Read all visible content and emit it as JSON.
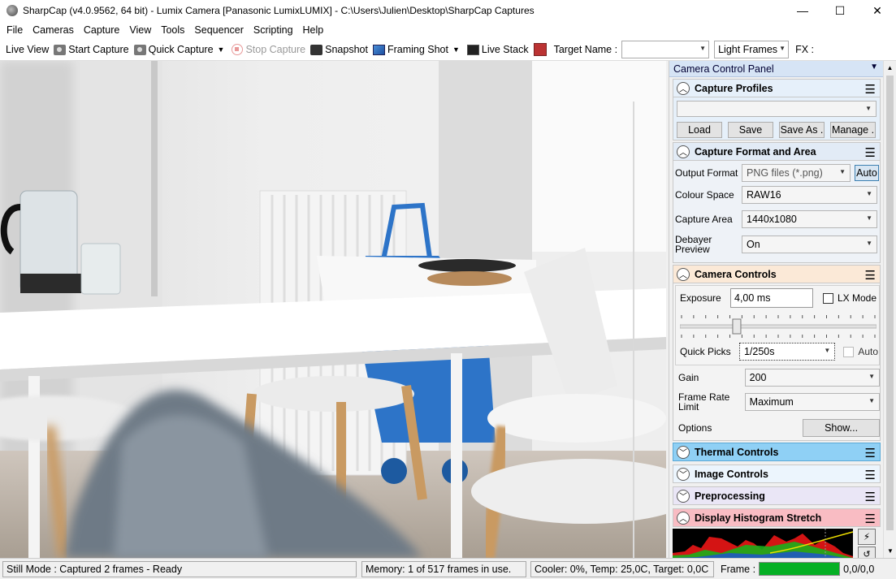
{
  "window": {
    "title": "SharpCap (v4.0.9562, 64 bit) - Lumix Camera [Panasonic LumixLUMIX] - C:\\Users\\Julien\\Desktop\\SharpCap Captures",
    "minimize": "—",
    "maximize": "☐",
    "close": "✕"
  },
  "menu": [
    "File",
    "Cameras",
    "Capture",
    "View",
    "Tools",
    "Sequencer",
    "Scripting",
    "Help"
  ],
  "toolbar": {
    "live_view": "Live View",
    "start_capture": "Start Capture",
    "quick_capture": "Quick Capture",
    "stop_capture": "Stop Capture",
    "snapshot": "Snapshot",
    "framing_shot": "Framing Shot",
    "live_stack": "Live Stack",
    "target_name_label": "Target Name :",
    "target_name_value": "",
    "frame_type": "Light Frames",
    "fx_label": "FX :"
  },
  "panel": {
    "title": "Camera Control Panel",
    "capture_profiles": {
      "title": "Capture Profiles",
      "profile": "",
      "load": "Load",
      "save": "Save",
      "save_as": "Save As .",
      "manage": "Manage ."
    },
    "format": {
      "title": "Capture Format and Area",
      "output_format_label": "Output Format",
      "output_format": "PNG files (*.png)",
      "auto": "Auto",
      "colour_space_label": "Colour Space",
      "colour_space": "RAW16",
      "capture_area_label": "Capture Area",
      "capture_area": "1440x1080",
      "debayer_label_1": "Debayer",
      "debayer_label_2": "Preview",
      "debayer": "On"
    },
    "camera": {
      "title": "Camera Controls",
      "exposure_label": "Exposure",
      "exposure": "4,00 ms",
      "lx_mode": "LX Mode",
      "quick_picks_label": "Quick Picks",
      "quick_picks": "1/250s",
      "qp_auto": "Auto",
      "gain_label": "Gain",
      "gain": "200",
      "frame_rate_label_1": "Frame Rate",
      "frame_rate_label_2": "Limit",
      "frame_rate": "Maximum",
      "options_label": "Options",
      "show": "Show...",
      "exposure_slider_fraction": 0.28
    },
    "thermal": {
      "title": "Thermal Controls"
    },
    "image": {
      "title": "Image Controls"
    },
    "preprocessing": {
      "title": "Preprocessing"
    },
    "histogram": {
      "title": "Display Histogram Stretch"
    },
    "colors": {
      "capture_profiles": "#e6f0fa",
      "format": "#e2ebf6",
      "camera": "#fbe9d7",
      "thermal": "#8fd0f5",
      "image": "#ecf5fd",
      "preprocessing": "#eae6f6",
      "histogram": "#f9bcc3"
    }
  },
  "status": {
    "mode": "Still Mode : Captured 2 frames - Ready",
    "memory": "Memory: 1 of 517 frames in use.",
    "cooler": "Cooler: 0%, Temp: 25,0C, Target: 0,0C",
    "frame_label": "Frame :",
    "frame_value": "0,0/0,0",
    "frame_progress": 1.0
  }
}
